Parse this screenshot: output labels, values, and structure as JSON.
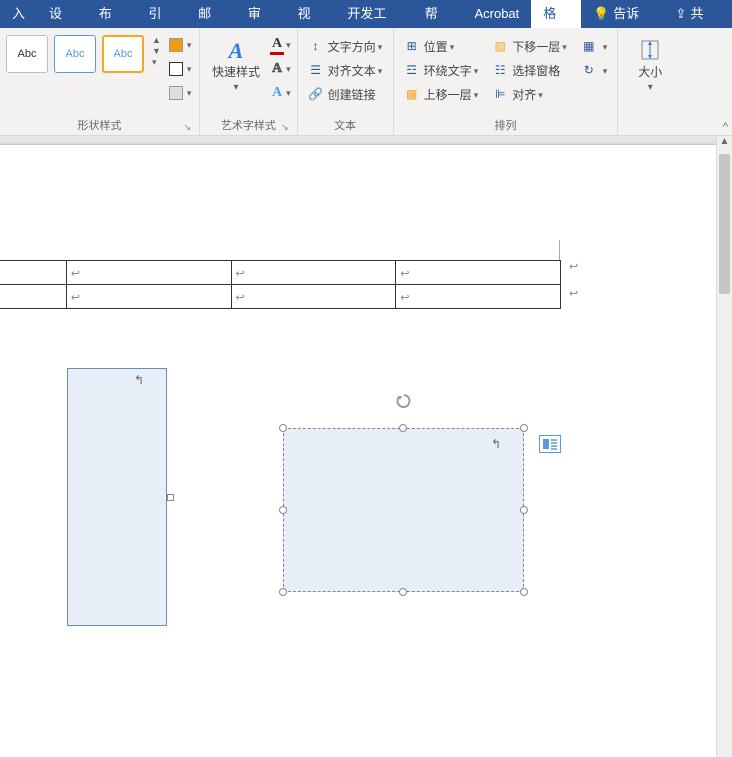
{
  "tabs": {
    "insert": "入",
    "design": "设计",
    "layout": "布局",
    "references": "引用",
    "mailings": "邮件",
    "review": "审阅",
    "view": "视图",
    "devtools": "开发工具",
    "help": "帮助",
    "acrobat": "Acrobat",
    "format": "格式",
    "tellme": "告诉我",
    "share": "共享"
  },
  "ribbon": {
    "shapeStyles": {
      "sample": "Abc",
      "label": "形状样式"
    },
    "wordArt": {
      "quickStyles": "快速样式",
      "label": "艺术字样式"
    },
    "text": {
      "textDirection": "文字方向",
      "alignText": "对齐文本",
      "createLink": "创建链接",
      "label": "文本"
    },
    "arrange": {
      "position": "位置",
      "wrapText": "环绕文字",
      "bringForward": "上移一层",
      "sendBackward": "下移一层",
      "selectionPane": "选择窗格",
      "align": "对齐",
      "label": "排列"
    },
    "size": {
      "label": "大小"
    }
  },
  "doc": {
    "paraMark": "↩",
    "shapeMark": "↰"
  }
}
